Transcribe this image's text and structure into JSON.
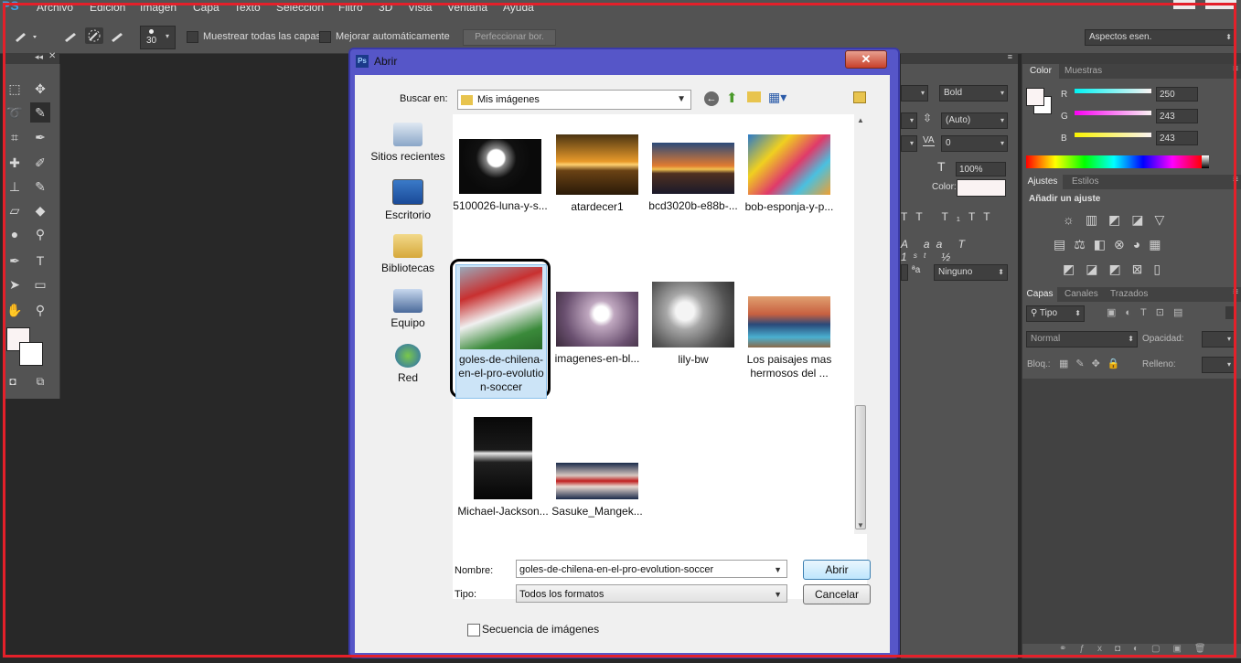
{
  "menubar": {
    "logo": "PS",
    "items": [
      "Archivo",
      "Edición",
      "Imagen",
      "Capa",
      "Texto",
      "Selección",
      "Filtro",
      "3D",
      "Vista",
      "Ventana",
      "Ayuda"
    ]
  },
  "options": {
    "brush_size": "30",
    "sample_all_label": "Muestrear todas las capas",
    "auto_enhance_label": "Mejorar automáticamente",
    "refine_edge_label": "Perfeccionar bor.",
    "workspace": "Aspectos esen."
  },
  "character_panel": {
    "font_style": "Bold",
    "leading": "(Auto)",
    "tracking": "0",
    "scale": "100%",
    "color_label": "Color:",
    "antialias": "Ninguno"
  },
  "color_panel": {
    "tabs": [
      "Color",
      "Muestras"
    ],
    "r_label": "R",
    "g_label": "G",
    "b_label": "B",
    "r": "250",
    "g": "243",
    "b": "243"
  },
  "adjustments_panel": {
    "tabs": [
      "Ajustes",
      "Estilos"
    ],
    "heading": "Añadir un ajuste"
  },
  "layers_panel": {
    "tabs": [
      "Capas",
      "Canales",
      "Trazados"
    ],
    "filter": "Tipo",
    "blend_mode": "Normal",
    "opacity_label": "Opacidad:",
    "lock_label": "Bloq.:",
    "fill_label": "Relleno:"
  },
  "dialog": {
    "title": "Abrir",
    "look_in_label": "Buscar en:",
    "look_in_value": "Mis imágenes",
    "places": [
      "Sitios recientes",
      "Escritorio",
      "Bibliotecas",
      "Equipo",
      "Red"
    ],
    "files": [
      "5100026-luna-y-s...",
      "atardecer1",
      "bcd3020b-e88b-...",
      "bob-esponja-y-p...",
      "goles-de-chilena-en-el-pro-evolution-soccer",
      "imagenes-en-bl...",
      "lily-bw",
      "Los paisajes mas hermosos del ...",
      "Michael-Jackson...",
      "Sasuke_Mangek..."
    ],
    "name_label": "Nombre:",
    "name_value": "goles-de-chilena-en-el-pro-evolution-soccer",
    "type_label": "Tipo:",
    "type_value": "Todos los formatos",
    "open_button": "Abrir",
    "cancel_button": "Cancelar",
    "sequence_label": "Secuencia de imágenes"
  }
}
